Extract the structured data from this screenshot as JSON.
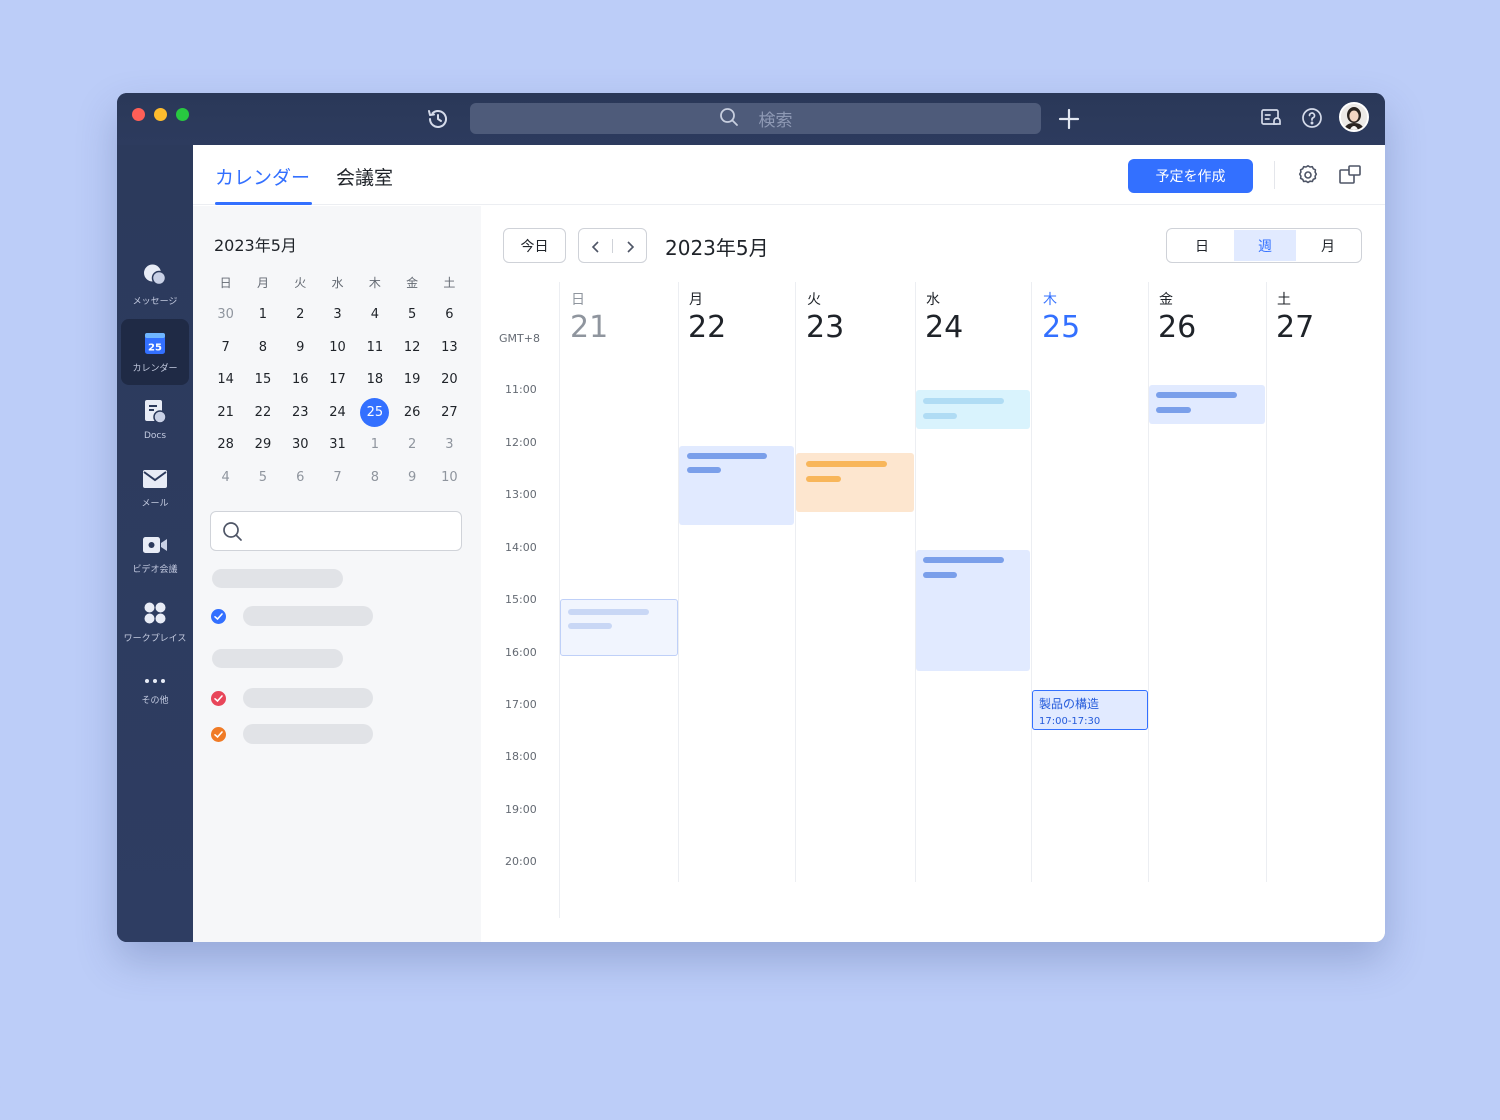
{
  "search": {
    "placeholder": "検索"
  },
  "rail": [
    {
      "label": "メッセージ",
      "icon": "chat-bubbles-icon"
    },
    {
      "label": "カレンダー",
      "icon": "calendar-icon",
      "badge": "25"
    },
    {
      "label": "Docs",
      "icon": "docs-icon"
    },
    {
      "label": "メール",
      "icon": "mail-icon"
    },
    {
      "label": "ビデオ会議",
      "icon": "video-camera-icon"
    },
    {
      "label": "ワークプレイス",
      "icon": "apps-grid-icon"
    },
    {
      "label": "その他",
      "icon": "more-dots-icon"
    }
  ],
  "tabs": {
    "calendar": "カレンダー",
    "rooms": "会議室"
  },
  "create_button": "予定を作成",
  "mini_calendar": {
    "title": "2023年5月",
    "weekdays": [
      "日",
      "月",
      "火",
      "水",
      "木",
      "金",
      "土"
    ],
    "weeks": [
      [
        "30",
        "1",
        "2",
        "3",
        "4",
        "5",
        "6"
      ],
      [
        "7",
        "8",
        "9",
        "10",
        "11",
        "12",
        "13"
      ],
      [
        "14",
        "15",
        "16",
        "17",
        "18",
        "19",
        "20"
      ],
      [
        "21",
        "22",
        "23",
        "24",
        "25",
        "26",
        "27"
      ],
      [
        "28",
        "29",
        "30",
        "31",
        "1",
        "2",
        "3"
      ],
      [
        "4",
        "5",
        "6",
        "7",
        "8",
        "9",
        "10"
      ]
    ],
    "today": "25"
  },
  "calendar_list_checks": [
    {
      "color": "#3370ff"
    },
    {
      "color": "#e8465a"
    },
    {
      "color": "#f07b26"
    }
  ],
  "week_view": {
    "today_button": "今日",
    "title": "2023年5月",
    "view_options": [
      "日",
      "週",
      "月"
    ],
    "active_view": "週",
    "timezone": "GMT+8",
    "hours": [
      "11:00",
      "12:00",
      "13:00",
      "14:00",
      "15:00",
      "16:00",
      "17:00",
      "18:00",
      "19:00",
      "20:00"
    ],
    "days": [
      {
        "name": "日",
        "num": "21"
      },
      {
        "name": "月",
        "num": "22"
      },
      {
        "name": "火",
        "num": "23"
      },
      {
        "name": "水",
        "num": "24"
      },
      {
        "name": "木",
        "num": "25"
      },
      {
        "name": "金",
        "num": "26"
      },
      {
        "name": "土",
        "num": "27"
      }
    ],
    "event": {
      "title": "製品の構造",
      "time": "17:00-17:30"
    }
  },
  "colors": {
    "accent": "#3370ff",
    "rail_bg": "#2c3a5c",
    "event_blue": "#e1eaff",
    "event_orange": "#fde6cf",
    "event_cyan": "#d9f3fd"
  }
}
